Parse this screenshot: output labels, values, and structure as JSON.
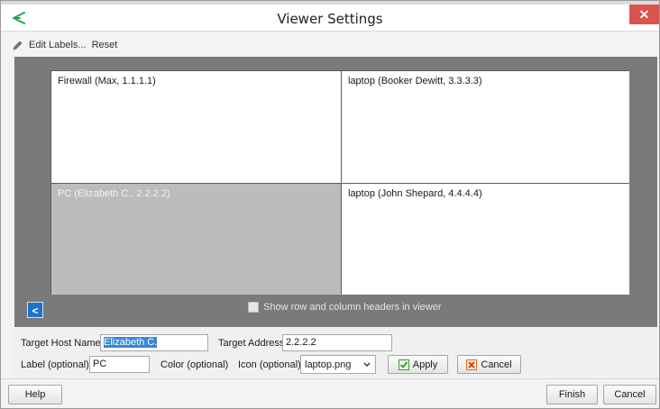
{
  "window": {
    "title": "Viewer Settings",
    "close_glyph": "✕"
  },
  "toolbar": {
    "edit_labels": "Edit Labels...",
    "reset": "Reset"
  },
  "viewer": {
    "cells": [
      {
        "label": "Firewall (Max, 1.1.1.1)",
        "selected": false
      },
      {
        "label": "laptop (Booker Dewitt, 3.3.3.3)",
        "selected": false
      },
      {
        "label": "PC (Elizabeth C., 2.2.2.2)",
        "selected": true
      },
      {
        "label": "laptop (John Shepard, 4.4.4.4)",
        "selected": false
      }
    ],
    "nav_glyph": "<",
    "show_headers_label": "Show row and column headers in viewer",
    "show_headers_checked": false
  },
  "form": {
    "target_host_name_label": "Target Host Name",
    "target_host_name_value": "Elizabeth C.",
    "target_address_label": "Target Address",
    "target_address_value": "2.2.2.2",
    "label_label": "Label (optional)",
    "label_value": "PC",
    "color_label": "Color (optional)",
    "icon_label": "Icon (optional)",
    "icon_value": "laptop.png",
    "apply": "Apply",
    "cancel": "Cancel"
  },
  "footer": {
    "help": "Help",
    "finish": "Finish",
    "cancel": "Cancel"
  },
  "colors": {
    "viewer_bg": "#7a7a7a",
    "selected_cell": "#bcbcbc",
    "close_button": "#d9534f",
    "accent_blue": "#1f73c6",
    "apply_green": "#3a9a2a",
    "cancel_orange": "#e06a1a"
  }
}
